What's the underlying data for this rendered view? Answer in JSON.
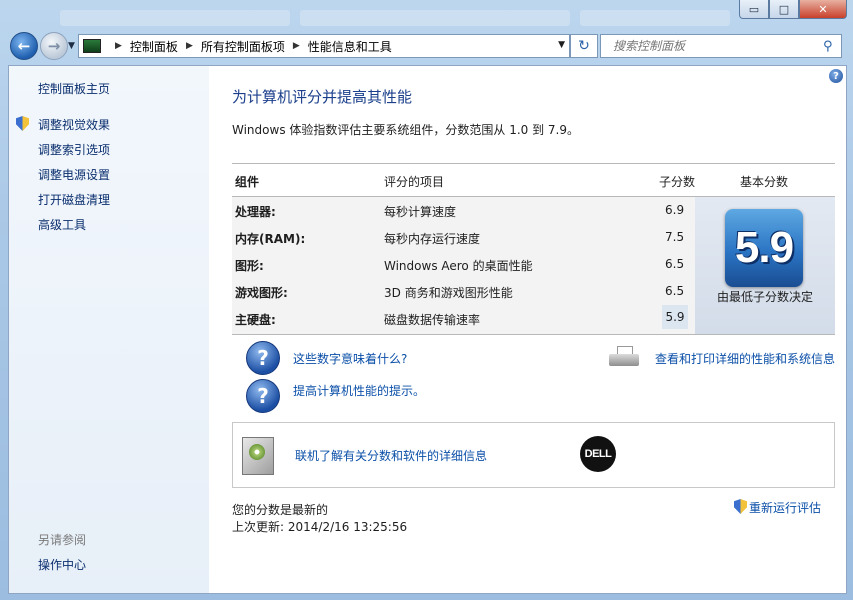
{
  "window": {
    "caption_buttons": {
      "minimize": "▭",
      "maximize": "□",
      "close": "✕"
    }
  },
  "nav": {
    "back": "←",
    "forward": "→",
    "breadcrumbs": [
      "控制面板",
      "所有控制面板项",
      "性能信息和工具"
    ],
    "search_placeholder": "搜索控制面板",
    "refresh": "↻"
  },
  "sidebar": {
    "home": "控制面板主页",
    "items": [
      "调整视觉效果",
      "调整索引选项",
      "调整电源设置",
      "打开磁盘清理",
      "高级工具"
    ],
    "see_also_title": "另请参阅",
    "see_also_items": [
      "操作中心"
    ]
  },
  "main": {
    "help": "?",
    "title": "为计算机评分并提高其性能",
    "subtitle": "Windows 体验指数评估主要系统组件，分数范围从 1.0 到 7.9。",
    "table": {
      "headers": {
        "component": "组件",
        "rated_item": "评分的项目",
        "subscore": "子分数",
        "base_score": "基本分数"
      },
      "rows": [
        {
          "component": "处理器:",
          "item": "每秒计算速度",
          "score": "6.9"
        },
        {
          "component": "内存(RAM):",
          "item": "每秒内存运行速度",
          "score": "7.5"
        },
        {
          "component": "图形:",
          "item": "Windows Aero 的桌面性能",
          "score": "6.5"
        },
        {
          "component": "游戏图形:",
          "item": "3D 商务和游戏图形性能",
          "score": "6.5"
        },
        {
          "component": "主硬盘:",
          "item": "磁盘数据传输速率",
          "score": "5.9"
        }
      ],
      "base_score": "5.9",
      "base_note": "由最低子分数决定"
    },
    "links": {
      "what_numbers": "这些数字意味着什么?",
      "tips": "提高计算机性能的提示。",
      "print_details": "查看和打印详细的性能和系统信息"
    },
    "info_box": {
      "text": "联机了解有关分数和软件的详细信息",
      "brand": "DELL"
    },
    "status": {
      "current": "您的分数是最新的",
      "last_update": "上次更新: 2014/2/16 13:25:56",
      "rerun": "重新运行评估"
    }
  }
}
